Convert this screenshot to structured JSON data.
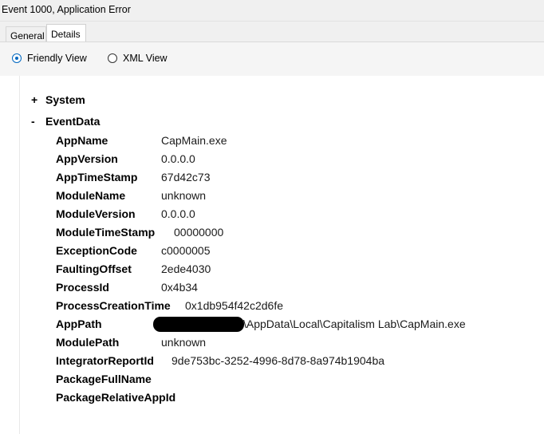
{
  "window": {
    "title": "Event 1000, Application Error"
  },
  "tabs": [
    {
      "label": "General"
    },
    {
      "label": "Details"
    }
  ],
  "view_options": {
    "friendly_label": "Friendly View",
    "xml_label": "XML View",
    "selected": "Friendly View"
  },
  "tree": {
    "system": {
      "sign": "+",
      "label": "System"
    },
    "eventdata": {
      "sign": "-",
      "label": "EventData"
    }
  },
  "event_data": [
    {
      "key": "AppName",
      "value": "CapMain.exe"
    },
    {
      "key": "AppVersion",
      "value": "0.0.0.0"
    },
    {
      "key": "AppTimeStamp",
      "value": "67d42c73"
    },
    {
      "key": "ModuleName",
      "value": "unknown"
    },
    {
      "key": "ModuleVersion",
      "value": "0.0.0.0"
    },
    {
      "key": "ModuleTimeStamp",
      "value": "00000000"
    },
    {
      "key": "ExceptionCode",
      "value": "c0000005"
    },
    {
      "key": "FaultingOffset",
      "value": "2ede4030"
    },
    {
      "key": "ProcessId",
      "value": "0x4b34"
    },
    {
      "key": "ProcessCreationTime",
      "value": "0x1db954f42c2d6fe"
    },
    {
      "key": "AppPath",
      "value": "\\AppData\\Local\\Capitalism Lab\\CapMain.exe"
    },
    {
      "key": "ModulePath",
      "value": "unknown"
    },
    {
      "key": "IntegratorReportId",
      "value": "9de753bc-3252-4996-8d78-8a974b1904ba"
    },
    {
      "key": "PackageFullName",
      "value": ""
    },
    {
      "key": "PackageRelativeAppId",
      "value": ""
    }
  ]
}
